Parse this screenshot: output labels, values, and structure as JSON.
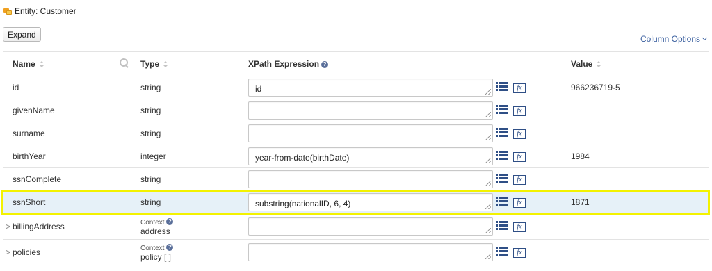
{
  "entity": {
    "label": "Entity: Customer",
    "icon": "entity-icon"
  },
  "toolbar": {
    "expand_label": "Expand",
    "column_options_label": "Column Options"
  },
  "columns": {
    "name": "Name",
    "type": "Type",
    "xpath": "XPath Expression",
    "value": "Value"
  },
  "help_glyph": "?",
  "fx_label": "fx",
  "context_label": "Context",
  "caret": ">",
  "rows": [
    {
      "name": "id",
      "type": "string",
      "xpath": "id",
      "value": "966236719-5"
    },
    {
      "name": "givenName",
      "type": "string",
      "xpath": "",
      "value": ""
    },
    {
      "name": "surname",
      "type": "string",
      "xpath": "",
      "value": ""
    },
    {
      "name": "birthYear",
      "type": "integer",
      "xpath": "year-from-date(birthDate)",
      "value": "1984"
    },
    {
      "name": "ssnComplete",
      "type": "string",
      "xpath": "",
      "value": ""
    },
    {
      "name": "ssnShort",
      "type": "string",
      "xpath": "substring(nationalID, 6, 4)",
      "value": "1871",
      "highlighted": true
    },
    {
      "name": "billingAddress",
      "type": "address",
      "xpath": "",
      "value": "",
      "context": true
    },
    {
      "name": "policies",
      "type": "policy [ ]",
      "xpath": "",
      "value": "",
      "context": true
    }
  ],
  "colors": {
    "highlight_outline": "#f3f200",
    "highlight_bg": "#e6f1f8",
    "link": "#3a5f9f",
    "icon": "#2f4f86"
  }
}
